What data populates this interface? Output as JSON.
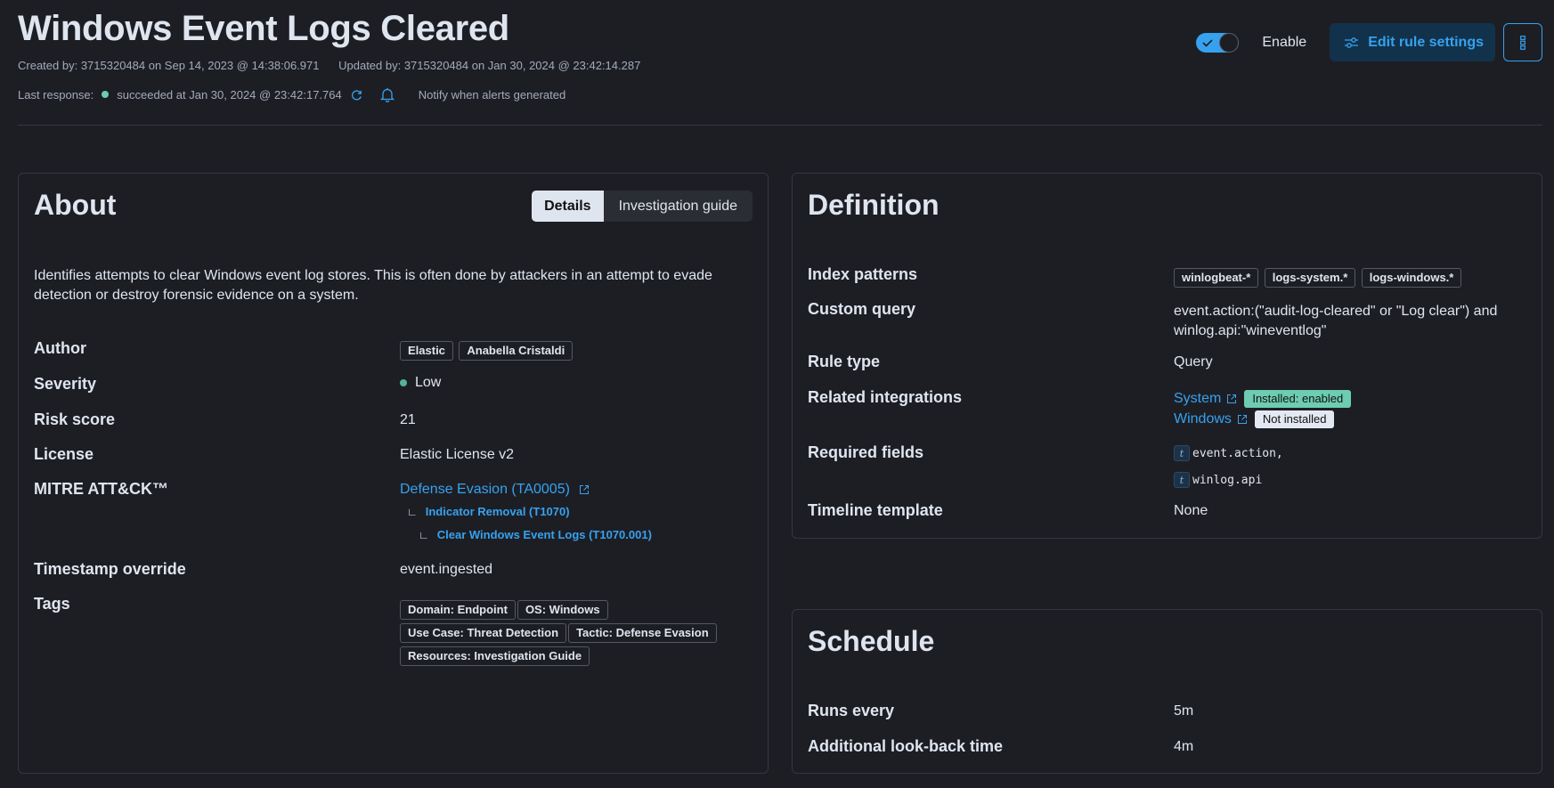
{
  "header": {
    "title": "Windows Event Logs Cleared",
    "created": "Created by: 3715320484 on Sep 14, 2023 @ 14:38:06.971",
    "updated": "Updated by: 3715320484 on Jan 30, 2024 @ 23:42:14.287",
    "last_response_label": "Last response:",
    "last_response_status": "succeeded at Jan 30, 2024 @ 23:42:17.764",
    "status_color": "#6dccb1",
    "notify_text": "Notify when alerts generated",
    "icons": {
      "refresh": "refresh-icon",
      "bell": "bell-icon"
    }
  },
  "actions": {
    "enabled": true,
    "enable_label": "Enable",
    "edit_label": "Edit rule settings",
    "more_icon": "boxes-vertical-icon",
    "accent": "#36a2ef"
  },
  "about": {
    "title": "About",
    "tabs": [
      {
        "label": "Details",
        "active": true
      },
      {
        "label": "Investigation guide",
        "active": false
      }
    ],
    "description": "Identifies attempts to clear Windows event log stores. This is often done by attackers in an attempt to evade detection or destroy forensic evidence on a system.",
    "author": {
      "label": "Author",
      "values": [
        "Elastic",
        "Anabella Cristaldi"
      ]
    },
    "severity": {
      "label": "Severity",
      "value": "Low",
      "color": "#54b399"
    },
    "risk_score": {
      "label": "Risk score",
      "value": "21"
    },
    "license": {
      "label": "License",
      "value": "Elastic License v2"
    },
    "mitre": {
      "label": "MITRE ATT&CK™",
      "tactic": "Defense Evasion (TA0005)",
      "technique": "Indicator Removal (T1070)",
      "subtechnique": "Clear Windows Event Logs (T1070.001)"
    },
    "timestamp_override": {
      "label": "Timestamp override",
      "value": "event.ingested"
    },
    "tags": {
      "label": "Tags",
      "values": [
        "Domain: Endpoint",
        "OS: Windows",
        "Use Case: Threat Detection",
        "Tactic: Defense Evasion",
        "Resources: Investigation Guide"
      ]
    }
  },
  "definition": {
    "title": "Definition",
    "index_patterns": {
      "label": "Index patterns",
      "values": [
        "winlogbeat-*",
        "logs-system.*",
        "logs-windows.*"
      ]
    },
    "custom_query": {
      "label": "Custom query",
      "value": "event.action:(\"audit-log-cleared\" or \"Log clear\") and winlog.api:\"wineventlog\""
    },
    "rule_type": {
      "label": "Rule type",
      "value": "Query"
    },
    "related_integrations": {
      "label": "Related integrations",
      "items": [
        {
          "name": "System",
          "status": "Installed: enabled",
          "status_color": "#6dccb1"
        },
        {
          "name": "Windows",
          "status": "Not installed",
          "status_color": "#e3e8f2"
        }
      ]
    },
    "required_fields": {
      "label": "Required fields",
      "values": [
        "event.action,",
        "winlog.api"
      ],
      "token": "t"
    },
    "timeline_template": {
      "label": "Timeline template",
      "value": "None"
    }
  },
  "schedule": {
    "title": "Schedule",
    "runs_every": {
      "label": "Runs every",
      "value": "5m"
    },
    "look_back": {
      "label": "Additional look-back time",
      "value": "4m"
    }
  }
}
